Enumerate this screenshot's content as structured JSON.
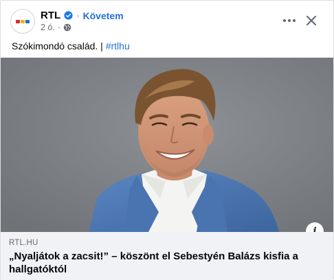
{
  "post": {
    "page_name": "RTL",
    "follow_label": "Követem",
    "separator": "·",
    "timestamp": "2 ó.",
    "meta_separator": "·",
    "caption_text": "Szókimondó család. | ",
    "hashtag": "#rtlhu"
  },
  "link": {
    "domain": "RTL.HU",
    "headline": "„Nyaljátok a zacsit!” – köszönt el Sebestyén Balázs kisfia a hallgatóktól"
  },
  "icons": {
    "verified": "verified-badge-icon",
    "globe": "globe-icon",
    "more": "more-options-icon",
    "close": "close-icon",
    "info": "info-icon"
  },
  "colors": {
    "link_blue": "#216fdb",
    "secondary_text": "#65676b",
    "link_box_bg": "#f0f2f5",
    "rtl_red": "#e4242b",
    "rtl_yellow": "#f5b400",
    "rtl_blue": "#1a6fd1"
  }
}
